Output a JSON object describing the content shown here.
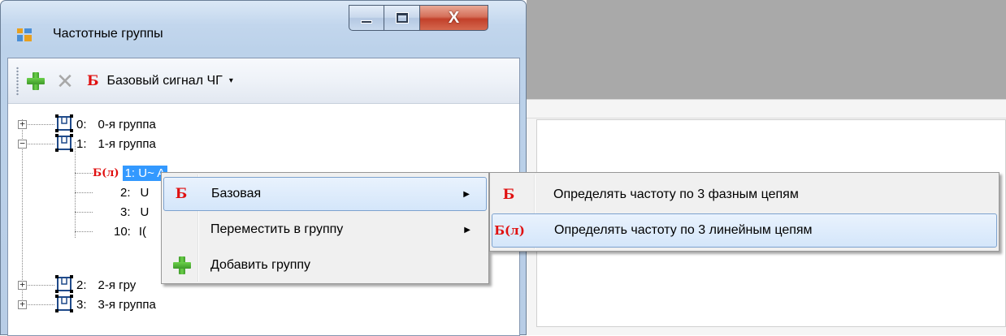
{
  "window": {
    "title": "Частотные группы",
    "close_glyph": "X"
  },
  "toolbar": {
    "add_icon": "plus-icon",
    "delete_icon": "x-icon",
    "base_letter": "Б",
    "base_dropdown_label": "Базовый сигнал ЧГ",
    "dropdown_arrow": "▾"
  },
  "tree": {
    "groups": [
      {
        "num": "0:",
        "label": "0-я группа",
        "expander": "+"
      },
      {
        "num": "1:",
        "label": "1-я группа",
        "expander": "−"
      },
      {
        "num": "2:",
        "label": "2-я гру",
        "expander": "+"
      },
      {
        "num": "3:",
        "label": "3-я группа",
        "expander": "+"
      }
    ],
    "children": [
      {
        "prefix": "Б(л)",
        "num": "1:",
        "label": "U~ A"
      },
      {
        "num": "2:",
        "label": "U"
      },
      {
        "num": "3:",
        "label": "U"
      },
      {
        "num": "10:",
        "label": "I("
      }
    ]
  },
  "context_menu": {
    "items": [
      {
        "icon_text": "Б",
        "label": "Базовая",
        "submenu": "▶"
      },
      {
        "label": "Переместить в группу",
        "submenu": "▶"
      },
      {
        "icon": "plus-icon",
        "label": "Добавить группу"
      }
    ]
  },
  "submenu": {
    "items": [
      {
        "icon_text": "Б",
        "label": "Определять частоту по 3 фазным цепям"
      },
      {
        "icon_text": "Б(л)",
        "label": "Определять частоту по 3 линейным цепям"
      }
    ]
  },
  "colors": {
    "accent_red": "#e01010",
    "selection": "#3399ff",
    "menu_hot": "#d4e6fa"
  }
}
